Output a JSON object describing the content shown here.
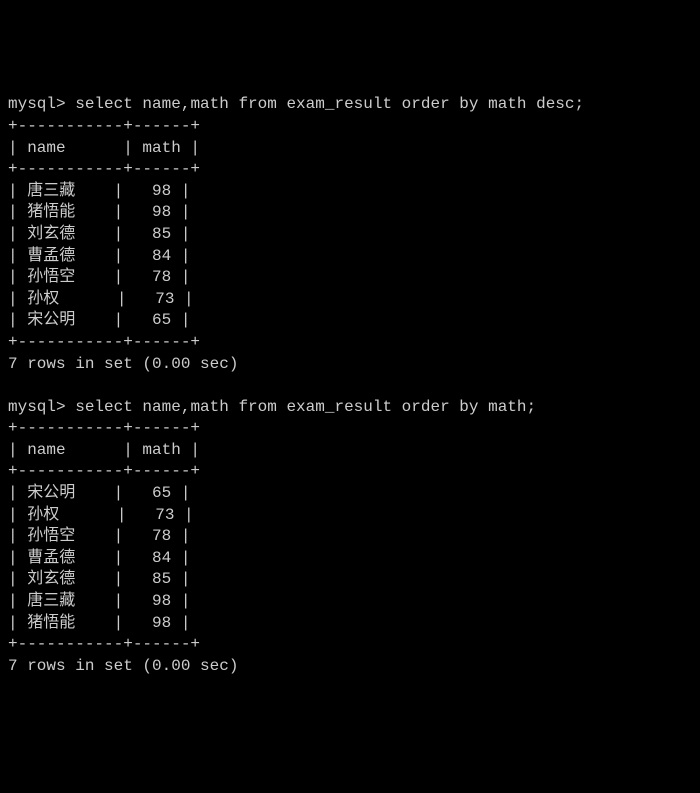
{
  "queries": [
    {
      "prompt": "mysql> ",
      "sql": "select name,math from exam_result order by math desc;",
      "sep": "+-----------+------+",
      "header": {
        "name": "name",
        "math": "math"
      },
      "rows": [
        {
          "name": "唐三藏",
          "math": "98"
        },
        {
          "name": "猪悟能",
          "math": "98"
        },
        {
          "name": "刘玄德",
          "math": "85"
        },
        {
          "name": "曹孟德",
          "math": "84"
        },
        {
          "name": "孙悟空",
          "math": "78"
        },
        {
          "name": "孙权",
          "math": "73"
        },
        {
          "name": "宋公明",
          "math": "65"
        }
      ],
      "footer": "7 rows in set (0.00 sec)"
    },
    {
      "prompt": "mysql> ",
      "sql": "select name,math from exam_result order by math;",
      "sep": "+-----------+------+",
      "header": {
        "name": "name",
        "math": "math"
      },
      "rows": [
        {
          "name": "宋公明",
          "math": "65"
        },
        {
          "name": "孙权",
          "math": "73"
        },
        {
          "name": "孙悟空",
          "math": "78"
        },
        {
          "name": "曹孟德",
          "math": "84"
        },
        {
          "name": "刘玄德",
          "math": "85"
        },
        {
          "name": "唐三藏",
          "math": "98"
        },
        {
          "name": "猪悟能",
          "math": "98"
        }
      ],
      "footer": "7 rows in set (0.00 sec)"
    }
  ]
}
